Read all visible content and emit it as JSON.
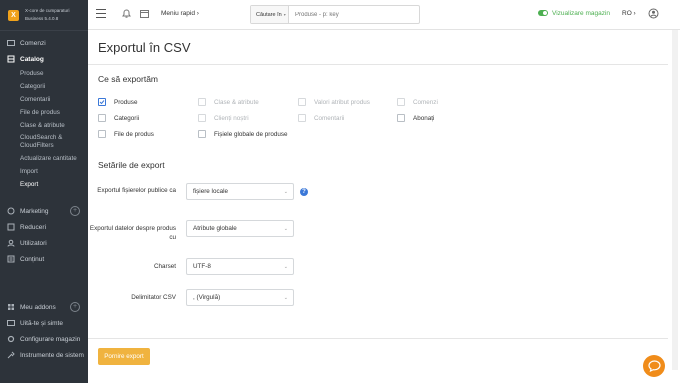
{
  "brand": {
    "line1": "X-core de cumparaturi",
    "line2": "Business 5.4.0.8"
  },
  "sidebar": {
    "items": [
      {
        "label": "Comenzi"
      },
      {
        "label": "Catalog"
      },
      {
        "label": "Marketing"
      },
      {
        "label": "Reduceri"
      },
      {
        "label": "Utilizatori"
      },
      {
        "label": "Conținut"
      },
      {
        "label": "Meu addons"
      },
      {
        "label": "Uită-te și simte"
      },
      {
        "label": "Configurare magazin"
      },
      {
        "label": "Instrumente de sistem"
      }
    ],
    "catalog_sub": [
      "Produse",
      "Categorii",
      "Comentarii",
      "File de produs",
      "Clase & atribute",
      "CloudSearch & CloudFilters",
      "Actualizare cantitate",
      "Import",
      "Export"
    ]
  },
  "topbar": {
    "quick_menu": "Meniu rapid ›",
    "search_select": "Căutare în",
    "search_placeholder": "Produse - p: key",
    "visualize": "Vizualizare magazin",
    "lang": "RO ›",
    "user_caret": "›"
  },
  "page": {
    "title": "Exportul în CSV",
    "what_heading": "Ce să exportăm",
    "settings_heading": "Setările de export",
    "start_button": "Pornire export"
  },
  "export_items": [
    {
      "label": "Produse",
      "checked": true,
      "disabled": false
    },
    {
      "label": "Clase & atribute",
      "checked": false,
      "disabled": true
    },
    {
      "label": "Valori atribut produs",
      "checked": false,
      "disabled": true
    },
    {
      "label": "Comenzi",
      "checked": false,
      "disabled": true
    },
    {
      "label": "Categorii",
      "checked": false,
      "disabled": false
    },
    {
      "label": "Clienți noștri",
      "checked": false,
      "disabled": true
    },
    {
      "label": "Comentarii",
      "checked": false,
      "disabled": true
    },
    {
      "label": "Abonați",
      "checked": false,
      "disabled": false
    },
    {
      "label": "File de produs",
      "checked": false,
      "disabled": false
    },
    {
      "label": "Fișiele globale de produse",
      "checked": false,
      "disabled": false
    }
  ],
  "settings": [
    {
      "label": "Exportul fișierelor publice ca",
      "value": "fișiere locale"
    },
    {
      "label": "Exportul datelor despre produs cu",
      "value": "Atribute globale"
    },
    {
      "label": "Charset",
      "value": "UTF-8"
    },
    {
      "label": "Delimitator CSV",
      "value": ", (Virgulă)"
    }
  ],
  "help_icon_text": "?",
  "colors": {
    "sidebar": "#2d333a",
    "accent": "#f0b33f",
    "toggle": "#4caf50",
    "link": "#3b78d8"
  }
}
